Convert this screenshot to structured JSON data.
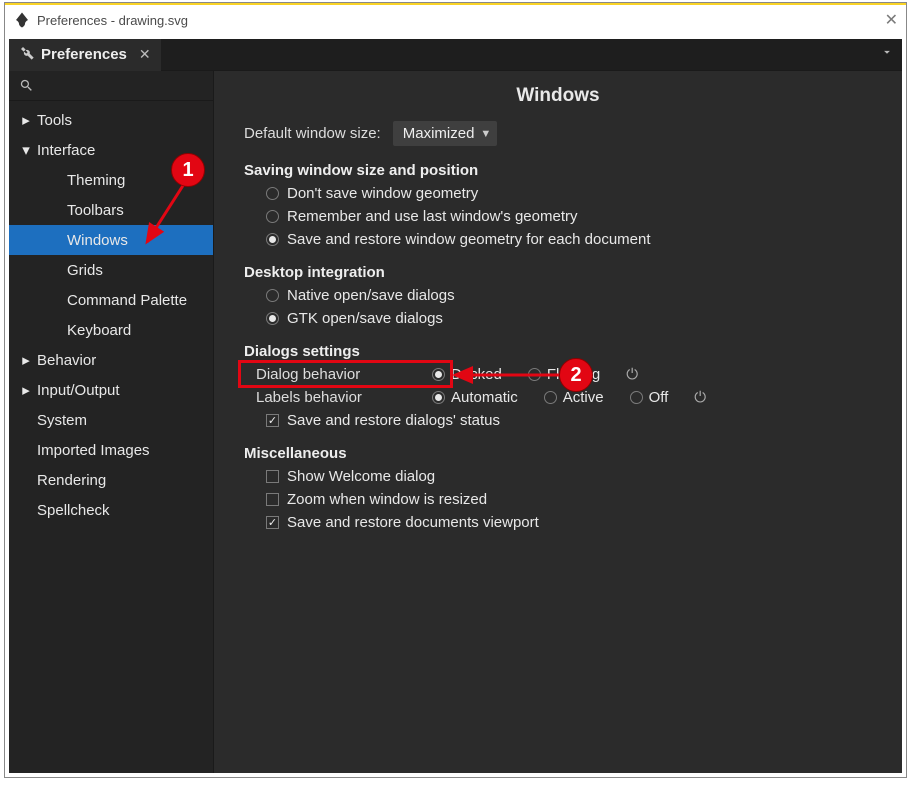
{
  "window_title": "Preferences - drawing.svg",
  "tab_label": "Preferences",
  "sidebar": {
    "items": [
      {
        "label": "Tools",
        "level": 0,
        "expandable": true,
        "expanded": false
      },
      {
        "label": "Interface",
        "level": 0,
        "expandable": true,
        "expanded": true
      },
      {
        "label": "Theming",
        "level": 1
      },
      {
        "label": "Toolbars",
        "level": 1
      },
      {
        "label": "Windows",
        "level": 1,
        "selected": true
      },
      {
        "label": "Grids",
        "level": 1
      },
      {
        "label": "Command Palette",
        "level": 1
      },
      {
        "label": "Keyboard",
        "level": 1
      },
      {
        "label": "Behavior",
        "level": 0,
        "expandable": true,
        "expanded": false
      },
      {
        "label": "Input/Output",
        "level": 0,
        "expandable": true,
        "expanded": false
      },
      {
        "label": "System",
        "level": 0,
        "expandable": false
      },
      {
        "label": "Imported Images",
        "level": 0,
        "expandable": false
      },
      {
        "label": "Rendering",
        "level": 0,
        "expandable": false
      },
      {
        "label": "Spellcheck",
        "level": 0,
        "expandable": false
      }
    ]
  },
  "main": {
    "title": "Windows",
    "default_size_label": "Default window size:",
    "default_size_value": "Maximized",
    "sections": {
      "saving": {
        "title": "Saving window size and position",
        "opt_dont_save": "Don't save window geometry",
        "opt_remember": "Remember and use last window's geometry",
        "opt_save_each": "Save and restore window geometry for each document"
      },
      "desktop": {
        "title": "Desktop integration",
        "opt_native": "Native open/save dialogs",
        "opt_gtk": "GTK open/save dialogs"
      },
      "dialogs": {
        "title": "Dialogs settings",
        "behavior_label": "Dialog behavior",
        "behavior_docked": "Docked",
        "behavior_floating": "Floating",
        "labels_label": "Labels behavior",
        "labels_automatic": "Automatic",
        "labels_active": "Active",
        "labels_off": "Off",
        "save_status": "Save and restore dialogs' status"
      },
      "misc": {
        "title": "Miscellaneous",
        "show_welcome": "Show Welcome dialog",
        "zoom_resized": "Zoom when window is resized",
        "save_viewport": "Save and restore documents viewport"
      }
    }
  },
  "annotations": {
    "one": "1",
    "two": "2"
  }
}
